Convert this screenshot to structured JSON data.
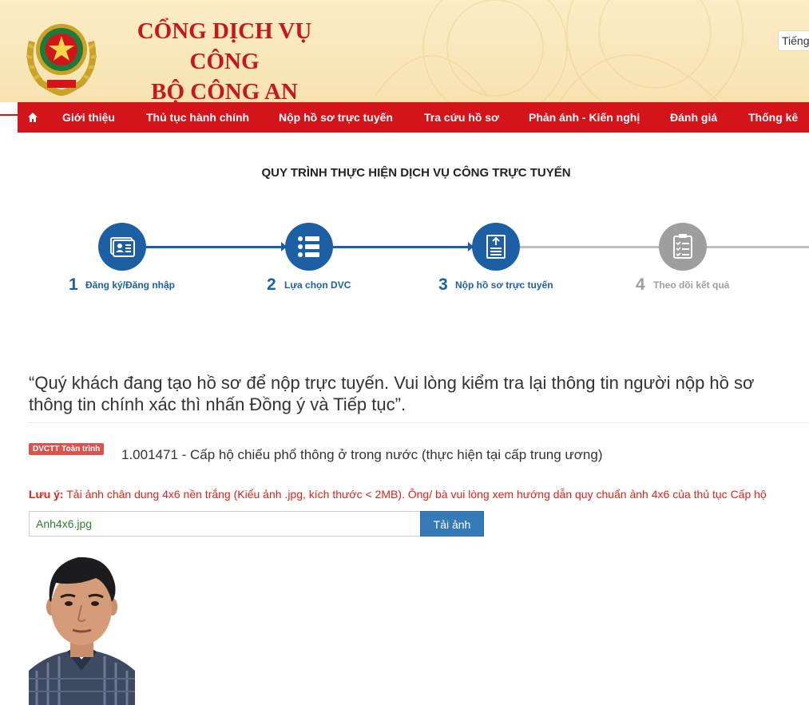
{
  "header": {
    "brand_line1": "CỔNG DỊCH VỤ CÔNG",
    "brand_line2": "BỘ CÔNG AN",
    "language": "Tiếng"
  },
  "nav": {
    "items": [
      {
        "label": "Giới thiệu"
      },
      {
        "label": "Thủ tục hành chính"
      },
      {
        "label": "Nộp hồ sơ trực tuyến"
      },
      {
        "label": "Tra cứu hồ sơ"
      },
      {
        "label": "Phản ánh - Kiến nghị"
      },
      {
        "label": "Đánh giá"
      },
      {
        "label": "Thống kê"
      }
    ]
  },
  "process": {
    "title": "QUY TRÌNH THỰC HIỆN DỊCH VỤ CÔNG TRỰC TUYẾN",
    "steps": [
      {
        "num": "1",
        "label": "Đăng ký/Đăng nhập",
        "status": "done"
      },
      {
        "num": "2",
        "label": "Lựa chọn DVC",
        "status": "done"
      },
      {
        "num": "3",
        "label": "Nộp hồ sơ trực tuyến",
        "status": "active"
      },
      {
        "num": "4",
        "label": "Theo dõi kết quả",
        "status": "pending"
      }
    ],
    "colors": {
      "active": "#1d5fa5",
      "pending": "#9e9e9e"
    }
  },
  "notice": {
    "line1": "“Quý khách đang tạo hồ sơ để nộp trực tuyến. Vui lòng kiểm tra lại thông tin người nộp hồ sơ",
    "line2": "thông tin chính xác thì nhấn Đồng ý và Tiếp tục”."
  },
  "procedure": {
    "badge": "DVCTT Toàn trình",
    "code": "1.001471",
    "name": " - Cấp hộ chiếu phổ thông ở trong nước (thực hiện tại cấp trung ương)"
  },
  "note": {
    "label": "Lưu ý:",
    "text": " Tải ảnh chân dung 4x6 nền trắng (Kiểu ảnh .jpg, kích thước < 2MB). Ông/ bà vui lòng xem hướng dẫn quy chuẩn ảnh 4x6 của thủ tục Cấp hộ"
  },
  "upload": {
    "filename": "Anh4x6.jpg",
    "button": "Tải ảnh"
  },
  "icons": {
    "emblem": "police-emblem-icon",
    "home": "home-icon",
    "step1": "id-card-icon",
    "step2": "list-icon",
    "step3": "document-upload-icon",
    "step4": "clipboard-checklist-icon"
  }
}
